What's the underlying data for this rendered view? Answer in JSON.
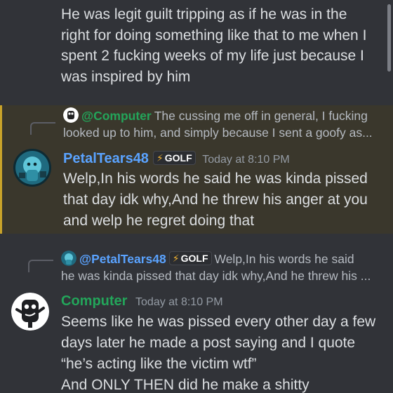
{
  "top_message": {
    "text": "He was legit guilt tripping as if he was in the right for doing something like that to me when I spent 2 fucking weeks of my life just because I was inspired by him"
  },
  "message1": {
    "reply": {
      "mention": "@Computer",
      "text_line1": "The cussing me off in general, I fucking",
      "text_line2": "looked up to him, and simply because I sent a goofy as..."
    },
    "author": "PetalTears48",
    "tag": "GOLF",
    "timestamp": "Today at 8:10 PM",
    "body": "Welp,In his words he said he was kinda pissed that day idk why,And he threw his anger at you and welp he regret doing that"
  },
  "message2": {
    "reply": {
      "mention": "@PetalTears48",
      "tag": "GOLF",
      "text_line1": "Welp,In his words he said",
      "text_line2": "he was kinda pissed that day idk why,And he threw his ..."
    },
    "author": "Computer",
    "timestamp": "Today at 8:10 PM",
    "body": "Seems like he was pissed every other day a few days later he made a post saying and I quote “he’s acting like the victim wtf”",
    "body_cut": "And ONLY THEN did he make a shitty"
  },
  "colors": {
    "background": "#313338",
    "highlight_bg": "#3a372c",
    "highlight_bar": "#c9a32a",
    "name_blue": "#5aa3ff",
    "name_green": "#23a55a"
  },
  "icons": {
    "tag_icon": "lightning-bolt-icon",
    "avatar_petal": "blue-character-avatar",
    "avatar_computer": "cartoon-face-avatar"
  }
}
